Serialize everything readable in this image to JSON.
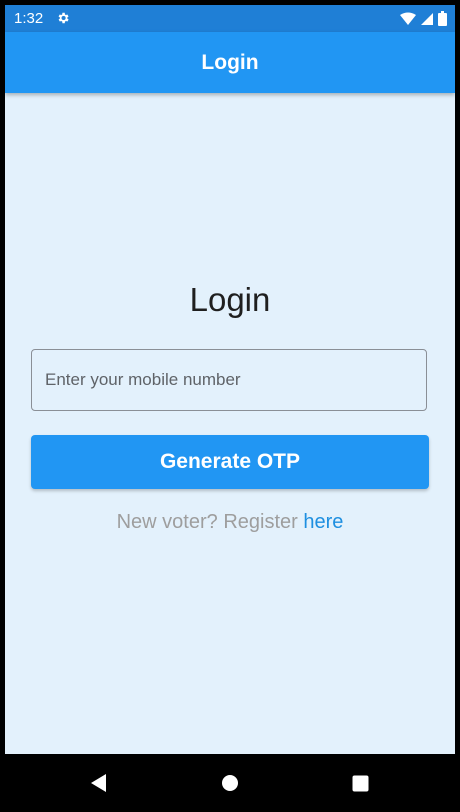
{
  "status_bar": {
    "time": "1:32",
    "icons": [
      "gear-icon",
      "wifi-icon",
      "signal-icon",
      "battery-icon"
    ]
  },
  "app_bar": {
    "title": "Login",
    "color": "#2196f3"
  },
  "main": {
    "heading": "Login",
    "mobile_field": {
      "value": "",
      "placeholder": "Enter your mobile number"
    },
    "generate_button_label": "Generate OTP",
    "register_prefix": "New voter? Register ",
    "register_link": "here"
  },
  "nav_bar": {
    "icons": [
      "back-icon",
      "home-icon",
      "recents-icon"
    ]
  },
  "colors": {
    "primary": "#2196f3",
    "status_bar": "#1f7fd6",
    "background": "#e3f1fc",
    "link": "#1e8fe0",
    "muted_text": "#9e9e9e"
  }
}
